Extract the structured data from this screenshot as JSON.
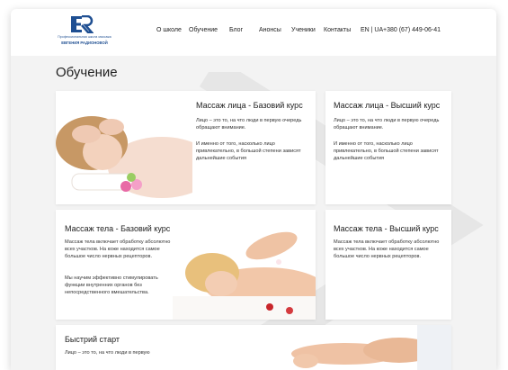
{
  "header": {
    "logo_text": "ER",
    "logo_line1": "Профессиональная школа массажа",
    "logo_line2": "ЕВГЕНИЯ РАДИОНОВОЙ",
    "nav": [
      "О школе",
      "Обучение",
      "Блог",
      "Анонсы",
      "Ученики",
      "Контакты",
      "EN | UA"
    ],
    "phone": "+380 (67) 449-06-41"
  },
  "main": {
    "title": "Обучение",
    "courses": [
      {
        "title": "Массаж лица - Базовий курс",
        "p1": "Лицо – это то, на что люди в первую очередь обращают внимание.",
        "p2": "И именно от того, насколько лицо привлекательно, в большой степени зависят дальнейшие события"
      },
      {
        "title": "Массаж лица - Высший курс",
        "p1": "Лицо – это то, на что люди в первую очередь обращают внимание.",
        "p2": "И именно от того, насколько лицо привлекательно, в большой степени зависят дальнейшие события"
      },
      {
        "title": "Массаж тела - Базовий курс",
        "p1": "Массаж тела включает обработку абсолютно всех участков. На коже находится самое большое число нервных рецепторов.",
        "p2": "Мы научим  эффективно стимулировать функции внутренних органов без непосредственного вмешательства."
      },
      {
        "title": "Массаж тела - Высший курс",
        "p1": "Массаж тела включает обработку абсолютно всех участков. На коже находится самое большое число нервных рецепторов."
      },
      {
        "title": "Быстрий старт",
        "p1": "Лицо – это то, на что люди в первую"
      }
    ]
  },
  "colors": {
    "brand": "#1f4f92",
    "page_bg": "#f3f3f3",
    "card_bg": "#ffffff"
  }
}
